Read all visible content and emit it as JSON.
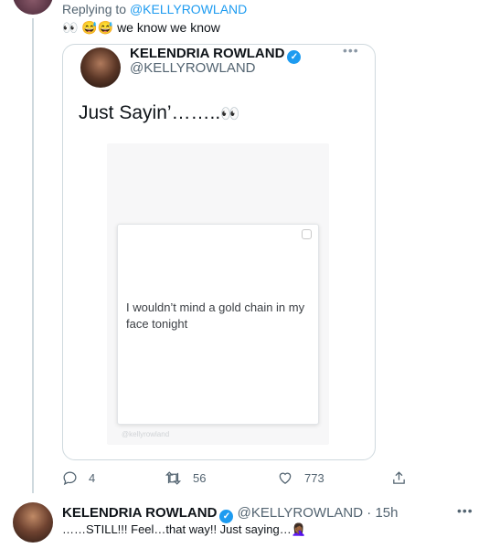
{
  "reply": {
    "prefix": "Replying to ",
    "handle": "@KELLYROWLAND",
    "text": "👀 😅😅 we know we know"
  },
  "quoted_tweet": {
    "name": "KELENDRIA ROWLAND",
    "handle": "@KELLYROWLAND",
    "more": "•••",
    "text": "Just Sayin’……..",
    "emoji": "👀",
    "note": {
      "text": "I wouldn’t mind a gold chain in my face tonight",
      "footer": "@kellyrowland"
    }
  },
  "actions": {
    "replies": "4",
    "retweets": "56",
    "likes": "773"
  },
  "next_tweet": {
    "name": "KELENDRIA ROWLAND",
    "handle": "@KELLYROWLAND",
    "separator": " · ",
    "time": "15h",
    "more": "•••",
    "text": "……STILL!!! Feel…that way!! Just saying…🤦🏾‍♀️"
  },
  "colors": {
    "link": "#1d9bf0",
    "muted": "#536471",
    "verified": "#1d9bf0",
    "border": "#cfd9de"
  }
}
